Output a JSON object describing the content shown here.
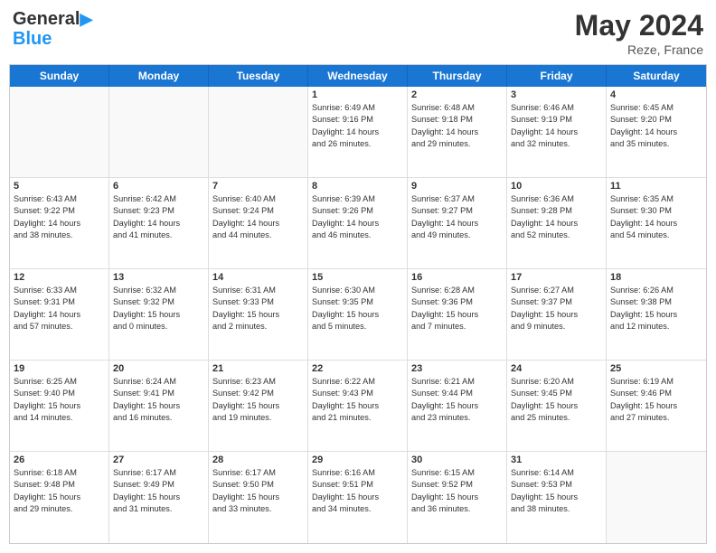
{
  "logo": {
    "line1": "General",
    "line2": "Blue"
  },
  "title": "May 2024",
  "location": "Reze, France",
  "header_days": [
    "Sunday",
    "Monday",
    "Tuesday",
    "Wednesday",
    "Thursday",
    "Friday",
    "Saturday"
  ],
  "rows": [
    [
      {
        "day": "",
        "info": "",
        "empty": true
      },
      {
        "day": "",
        "info": "",
        "empty": true
      },
      {
        "day": "",
        "info": "",
        "empty": true
      },
      {
        "day": "1",
        "info": "Sunrise: 6:49 AM\nSunset: 9:16 PM\nDaylight: 14 hours\nand 26 minutes."
      },
      {
        "day": "2",
        "info": "Sunrise: 6:48 AM\nSunset: 9:18 PM\nDaylight: 14 hours\nand 29 minutes."
      },
      {
        "day": "3",
        "info": "Sunrise: 6:46 AM\nSunset: 9:19 PM\nDaylight: 14 hours\nand 32 minutes."
      },
      {
        "day": "4",
        "info": "Sunrise: 6:45 AM\nSunset: 9:20 PM\nDaylight: 14 hours\nand 35 minutes."
      }
    ],
    [
      {
        "day": "5",
        "info": "Sunrise: 6:43 AM\nSunset: 9:22 PM\nDaylight: 14 hours\nand 38 minutes."
      },
      {
        "day": "6",
        "info": "Sunrise: 6:42 AM\nSunset: 9:23 PM\nDaylight: 14 hours\nand 41 minutes."
      },
      {
        "day": "7",
        "info": "Sunrise: 6:40 AM\nSunset: 9:24 PM\nDaylight: 14 hours\nand 44 minutes."
      },
      {
        "day": "8",
        "info": "Sunrise: 6:39 AM\nSunset: 9:26 PM\nDaylight: 14 hours\nand 46 minutes."
      },
      {
        "day": "9",
        "info": "Sunrise: 6:37 AM\nSunset: 9:27 PM\nDaylight: 14 hours\nand 49 minutes."
      },
      {
        "day": "10",
        "info": "Sunrise: 6:36 AM\nSunset: 9:28 PM\nDaylight: 14 hours\nand 52 minutes."
      },
      {
        "day": "11",
        "info": "Sunrise: 6:35 AM\nSunset: 9:30 PM\nDaylight: 14 hours\nand 54 minutes."
      }
    ],
    [
      {
        "day": "12",
        "info": "Sunrise: 6:33 AM\nSunset: 9:31 PM\nDaylight: 14 hours\nand 57 minutes."
      },
      {
        "day": "13",
        "info": "Sunrise: 6:32 AM\nSunset: 9:32 PM\nDaylight: 15 hours\nand 0 minutes."
      },
      {
        "day": "14",
        "info": "Sunrise: 6:31 AM\nSunset: 9:33 PM\nDaylight: 15 hours\nand 2 minutes."
      },
      {
        "day": "15",
        "info": "Sunrise: 6:30 AM\nSunset: 9:35 PM\nDaylight: 15 hours\nand 5 minutes."
      },
      {
        "day": "16",
        "info": "Sunrise: 6:28 AM\nSunset: 9:36 PM\nDaylight: 15 hours\nand 7 minutes."
      },
      {
        "day": "17",
        "info": "Sunrise: 6:27 AM\nSunset: 9:37 PM\nDaylight: 15 hours\nand 9 minutes."
      },
      {
        "day": "18",
        "info": "Sunrise: 6:26 AM\nSunset: 9:38 PM\nDaylight: 15 hours\nand 12 minutes."
      }
    ],
    [
      {
        "day": "19",
        "info": "Sunrise: 6:25 AM\nSunset: 9:40 PM\nDaylight: 15 hours\nand 14 minutes."
      },
      {
        "day": "20",
        "info": "Sunrise: 6:24 AM\nSunset: 9:41 PM\nDaylight: 15 hours\nand 16 minutes."
      },
      {
        "day": "21",
        "info": "Sunrise: 6:23 AM\nSunset: 9:42 PM\nDaylight: 15 hours\nand 19 minutes."
      },
      {
        "day": "22",
        "info": "Sunrise: 6:22 AM\nSunset: 9:43 PM\nDaylight: 15 hours\nand 21 minutes."
      },
      {
        "day": "23",
        "info": "Sunrise: 6:21 AM\nSunset: 9:44 PM\nDaylight: 15 hours\nand 23 minutes."
      },
      {
        "day": "24",
        "info": "Sunrise: 6:20 AM\nSunset: 9:45 PM\nDaylight: 15 hours\nand 25 minutes."
      },
      {
        "day": "25",
        "info": "Sunrise: 6:19 AM\nSunset: 9:46 PM\nDaylight: 15 hours\nand 27 minutes."
      }
    ],
    [
      {
        "day": "26",
        "info": "Sunrise: 6:18 AM\nSunset: 9:48 PM\nDaylight: 15 hours\nand 29 minutes."
      },
      {
        "day": "27",
        "info": "Sunrise: 6:17 AM\nSunset: 9:49 PM\nDaylight: 15 hours\nand 31 minutes."
      },
      {
        "day": "28",
        "info": "Sunrise: 6:17 AM\nSunset: 9:50 PM\nDaylight: 15 hours\nand 33 minutes."
      },
      {
        "day": "29",
        "info": "Sunrise: 6:16 AM\nSunset: 9:51 PM\nDaylight: 15 hours\nand 34 minutes."
      },
      {
        "day": "30",
        "info": "Sunrise: 6:15 AM\nSunset: 9:52 PM\nDaylight: 15 hours\nand 36 minutes."
      },
      {
        "day": "31",
        "info": "Sunrise: 6:14 AM\nSunset: 9:53 PM\nDaylight: 15 hours\nand 38 minutes."
      },
      {
        "day": "",
        "info": "",
        "empty": true
      }
    ]
  ]
}
